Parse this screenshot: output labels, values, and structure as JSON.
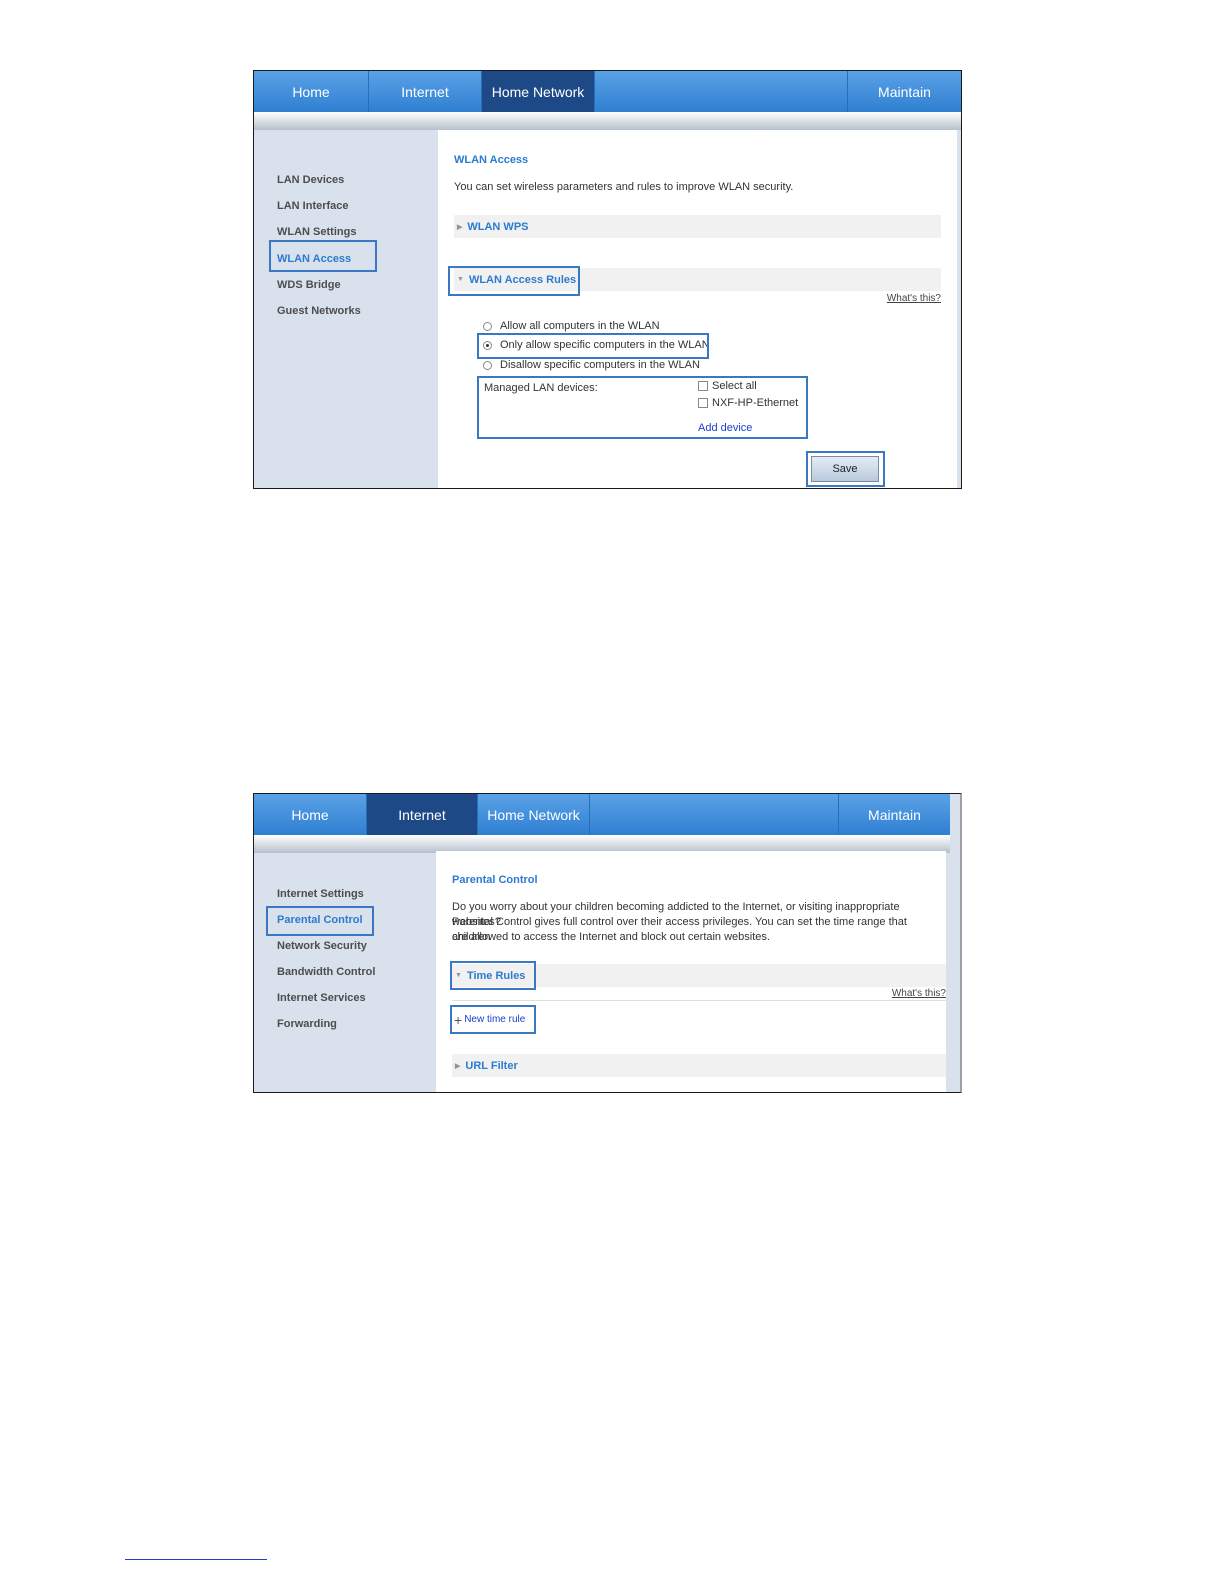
{
  "screen1": {
    "nav": {
      "home": "Home",
      "internet": "Internet",
      "home_network": "Home Network",
      "maintain": "Maintain"
    },
    "sidebar": [
      "LAN Devices",
      "LAN Interface",
      "WLAN Settings",
      "WLAN Access",
      "WDS Bridge",
      "Guest Networks"
    ],
    "title": "WLAN Access",
    "description": "You can set wireless parameters and rules to improve WLAN security.",
    "section_wps": "WLAN WPS",
    "section_rules": "WLAN Access Rules",
    "whats_this": "What's this?",
    "radio_all": "Allow all computers in the WLAN",
    "radio_only": "Only allow specific computers in the WLAN",
    "radio_disallow": "Disallow specific computers in the WLAN",
    "managed_label": "Managed LAN devices:",
    "select_all": "Select all",
    "device": "NXF-HP-Ethernet",
    "add_device": "Add device",
    "save": "Save"
  },
  "screen2": {
    "nav": {
      "home": "Home",
      "internet": "Internet",
      "home_network": "Home Network",
      "maintain": "Maintain"
    },
    "sidebar": [
      "Internet Settings",
      "Parental Control",
      "Network Security",
      "Bandwidth Control",
      "Internet Services",
      "Forwarding"
    ],
    "title": "Parental Control",
    "description_lines": [
      "Do you worry about your children becoming addicted to the Internet, or visiting inappropriate websites?",
      "Parental Control gives full control over their access privileges. You can set the time range that children",
      "are allowed to access the Internet and block out certain websites."
    ],
    "section_time": "Time Rules",
    "whats_this": "What's this?",
    "new_time_rule": "New time rule",
    "section_url": "URL Filter"
  }
}
